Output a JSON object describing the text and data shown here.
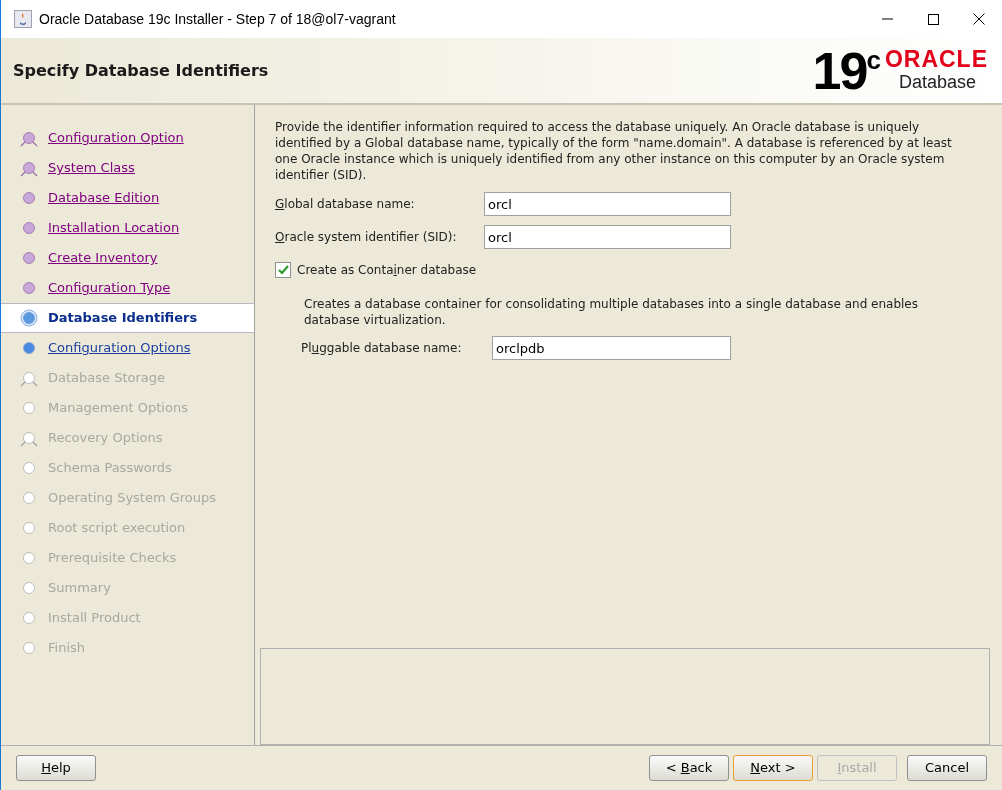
{
  "window": {
    "title": "Oracle Database 19c Installer - Step 7 of 18@ol7-vagrant"
  },
  "header": {
    "title": "Specify Database Identifiers",
    "logo_version": "19",
    "logo_superscript": "c",
    "logo_brand": "ORACLE",
    "logo_product": "Database"
  },
  "steps": [
    {
      "label": "Configuration Option",
      "kind": "done",
      "branch": true,
      "selected": false
    },
    {
      "label": "System Class",
      "kind": "done",
      "branch": true,
      "selected": false
    },
    {
      "label": "Database Edition",
      "kind": "done",
      "branch": false,
      "selected": false
    },
    {
      "label": "Installation Location",
      "kind": "done",
      "branch": false,
      "selected": false
    },
    {
      "label": "Create Inventory",
      "kind": "done",
      "branch": false,
      "selected": false
    },
    {
      "label": "Configuration Type",
      "kind": "done",
      "branch": false,
      "selected": false
    },
    {
      "label": "Database Identifiers",
      "kind": "current",
      "branch": false,
      "selected": true
    },
    {
      "label": "Configuration Options",
      "kind": "next",
      "branch": false,
      "selected": false
    },
    {
      "label": "Database Storage",
      "kind": "pending",
      "branch": true,
      "selected": false
    },
    {
      "label": "Management Options",
      "kind": "pending",
      "branch": false,
      "selected": false
    },
    {
      "label": "Recovery Options",
      "kind": "pending",
      "branch": true,
      "selected": false
    },
    {
      "label": "Schema Passwords",
      "kind": "pending",
      "branch": false,
      "selected": false
    },
    {
      "label": "Operating System Groups",
      "kind": "pending",
      "branch": false,
      "selected": false
    },
    {
      "label": "Root script execution",
      "kind": "pending",
      "branch": false,
      "selected": false
    },
    {
      "label": "Prerequisite Checks",
      "kind": "pending",
      "branch": false,
      "selected": false
    },
    {
      "label": "Summary",
      "kind": "pending",
      "branch": false,
      "selected": false
    },
    {
      "label": "Install Product",
      "kind": "pending",
      "branch": false,
      "selected": false
    },
    {
      "label": "Finish",
      "kind": "pending",
      "branch": false,
      "selected": false
    }
  ],
  "content": {
    "description": "Provide the identifier information required to access the database uniquely. An Oracle database is uniquely identified by a Global database name, typically of the form \"name.domain\". A database is referenced by at least one Oracle instance which is uniquely identified from any other instance on this computer by an Oracle system identifier (SID).",
    "fields": [
      {
        "label": {
          "key": "G",
          "after": "lobal database name:"
        },
        "value": "orcl"
      },
      {
        "label": {
          "key": "O",
          "after": "racle system identifier (SID):"
        },
        "value": "orcl"
      }
    ],
    "container_checkbox": {
      "label": {
        "before": "Create as Conta",
        "key": "i",
        "after": "ner database"
      },
      "checked": true
    },
    "container_description": "Creates a database container for consolidating multiple databases into a single database and enables database virtualization.",
    "pluggable_field": {
      "label": {
        "before": "Pl",
        "key": "u",
        "after": "ggable database name:"
      },
      "value": "orclpdb"
    }
  },
  "buttons": [
    {
      "label": {
        "key": "H",
        "after": "elp"
      },
      "disabled": false,
      "default": false
    },
    {
      "label": {
        "before": "< ",
        "key": "B",
        "after": "ack"
      },
      "disabled": false,
      "default": false
    },
    {
      "label": {
        "key": "N",
        "after": "ext >"
      },
      "disabled": false,
      "default": true
    },
    {
      "label": {
        "key": "I",
        "after": "nstall"
      },
      "disabled": true,
      "default": false
    },
    {
      "label": {
        "before": "Cancel"
      },
      "disabled": false,
      "default": false
    }
  ]
}
